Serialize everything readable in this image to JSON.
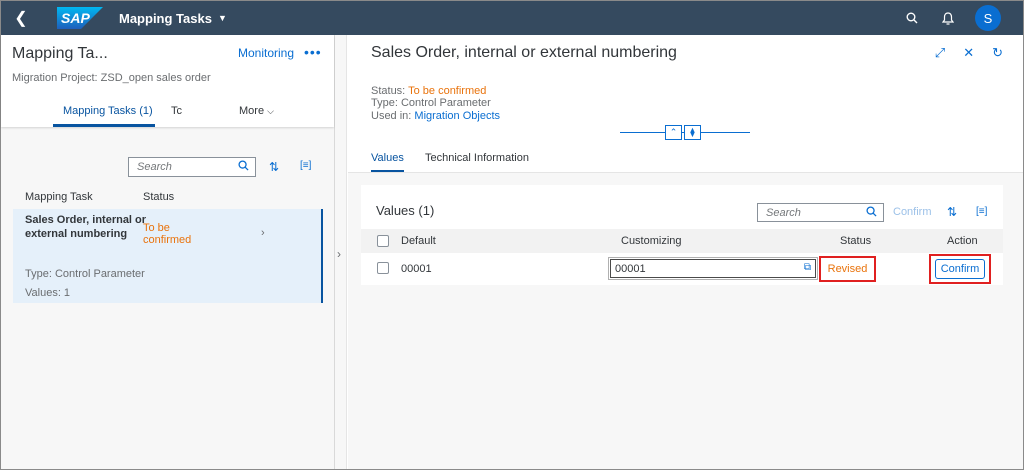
{
  "shell": {
    "logo_text": "SAP",
    "app_title": "Mapping Tasks",
    "avatar_initial": "S",
    "icons": [
      "back-icon",
      "search-icon",
      "bell-icon",
      "caret-down-icon"
    ],
    "brand_color": "#354a5f",
    "accent_color": "#0a6ed1"
  },
  "master": {
    "title": "Mapping Ta...",
    "monitoring_link": "Monitoring",
    "more_actions": "•••",
    "project": "Migration Project: ZSD_open sales order",
    "tabs": [
      {
        "label": "Mapping Tasks (1)"
      },
      {
        "label": "Tc"
      },
      {
        "label": "More"
      }
    ],
    "search_placeholder": "Search",
    "columns": [
      "Mapping Task",
      "Status"
    ],
    "rows": [
      {
        "title": "Sales Order, internal or external numbering",
        "status": "To be confirmed",
        "type": "Type:  Control Parameter",
        "values": "Values:  1"
      }
    ]
  },
  "detail": {
    "title": "Sales Order, internal or external numbering",
    "status_label": "Status:",
    "status_value": "To be confirmed",
    "type": "Type: Control Parameter",
    "used_in_label": "Used in:",
    "used_in_value": "Migration Objects",
    "tabs": [
      {
        "label": "Values"
      },
      {
        "label": "Technical Information"
      }
    ],
    "values": {
      "title": "Values (1)",
      "search_placeholder": "Search",
      "confirm_label": "Confirm",
      "columns": [
        "Default",
        "Customizing",
        "Status",
        "Action"
      ],
      "rows": [
        {
          "default": "00001",
          "customizing": "00001",
          "status": "Revised",
          "action": "Confirm"
        }
      ]
    },
    "status_color": "#e9730c",
    "highlight_color": "#e02020"
  }
}
